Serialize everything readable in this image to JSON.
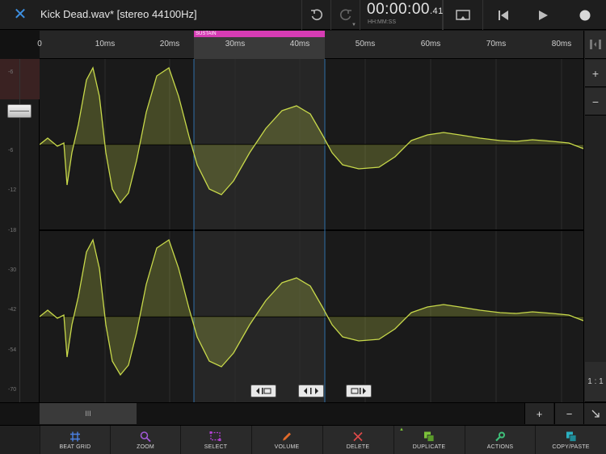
{
  "header": {
    "file_name": "Kick Dead.wav* [stereo 44100Hz]",
    "timecode_main": "00:00:00",
    "timecode_frac": ".41",
    "timecode_format": "HH:MM:SS"
  },
  "ruler": {
    "ticks": [
      "0",
      "10ms",
      "20ms",
      "30ms",
      "40ms",
      "50ms",
      "60ms",
      "70ms",
      "80ms"
    ],
    "region_label": "SUSTAIN"
  },
  "meter": {
    "db_labels": [
      "-6",
      "-6",
      "-12",
      "-18",
      "-30",
      "-42",
      "-54",
      "-70"
    ]
  },
  "right_panel": {
    "zoom_in": "+",
    "zoom_out": "−",
    "ratio": "1 : 1"
  },
  "scroll": {
    "thumb_label": "III",
    "plus": "+",
    "minus": "−"
  },
  "toolbar": {
    "items": [
      {
        "label": "BEAT GRID",
        "color": "#4a7fe0"
      },
      {
        "label": "ZOOM",
        "color": "#a25ad8"
      },
      {
        "label": "SELECT",
        "color": "#b040d0"
      },
      {
        "label": "VOLUME",
        "color": "#e06a2a"
      },
      {
        "label": "DELETE",
        "color": "#e04a4a"
      },
      {
        "label": "DUPLICATE",
        "color": "#7cc23a"
      },
      {
        "label": "ACTIONS",
        "color": "#3fc07a"
      },
      {
        "label": "COPY/PASTE",
        "color": "#2ab0c0"
      }
    ]
  },
  "colors": {
    "accent": "#3d8fe0",
    "sustain": "#d63cb4",
    "waveform": "#c8d94a"
  }
}
